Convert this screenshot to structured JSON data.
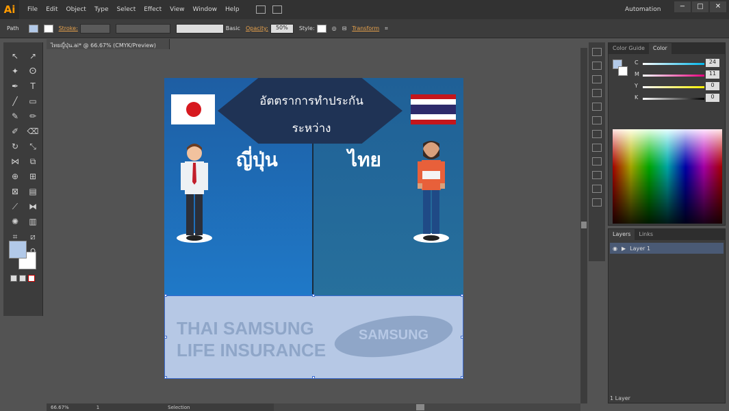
{
  "app": {
    "logo": "Ai",
    "menus": [
      "File",
      "Edit",
      "Object",
      "Type",
      "Select",
      "Effect",
      "View",
      "Window",
      "Help"
    ],
    "workspace": "Automation",
    "win_min": "−",
    "win_max": "□",
    "win_close": "✕"
  },
  "control": {
    "label": "Path",
    "stroke_label": "Stroke:",
    "stroke_style": "Basic",
    "opacity_label": "Opacity:",
    "opacity_value": "50%",
    "style_label": "Style:",
    "transform_label": "Transform"
  },
  "document": {
    "tab": "ไทยญี่ปุ่น.ai* @ 66.67% (CMYK/Preview)",
    "zoom": "66.67%",
    "page": "1",
    "status": "Selection"
  },
  "artboard": {
    "heading_line1": "อัตตราการทำประกัน",
    "heading_line2": "ระหว่าง",
    "left_title": "ญี่ปุ่น",
    "right_title": "ไทย",
    "logo_line1": "THAI SAMSUNG",
    "logo_line2": "LIFE INSURANCE",
    "brand": "SAMSUNG"
  },
  "colorpanel": {
    "tabs": [
      "Color Guide",
      "Color"
    ],
    "channels": [
      {
        "name": "C",
        "value": "24",
        "color": "#00b7eb"
      },
      {
        "name": "M",
        "value": "11",
        "color": "#e6007e"
      },
      {
        "name": "Y",
        "value": "0",
        "color": "#fff200"
      },
      {
        "name": "K",
        "value": "0",
        "color": "#000000"
      }
    ],
    "pct": "%"
  },
  "layers": {
    "tabs": [
      "Layers",
      "Links"
    ],
    "layer_name": "Layer 1",
    "count": "1 Layer"
  }
}
